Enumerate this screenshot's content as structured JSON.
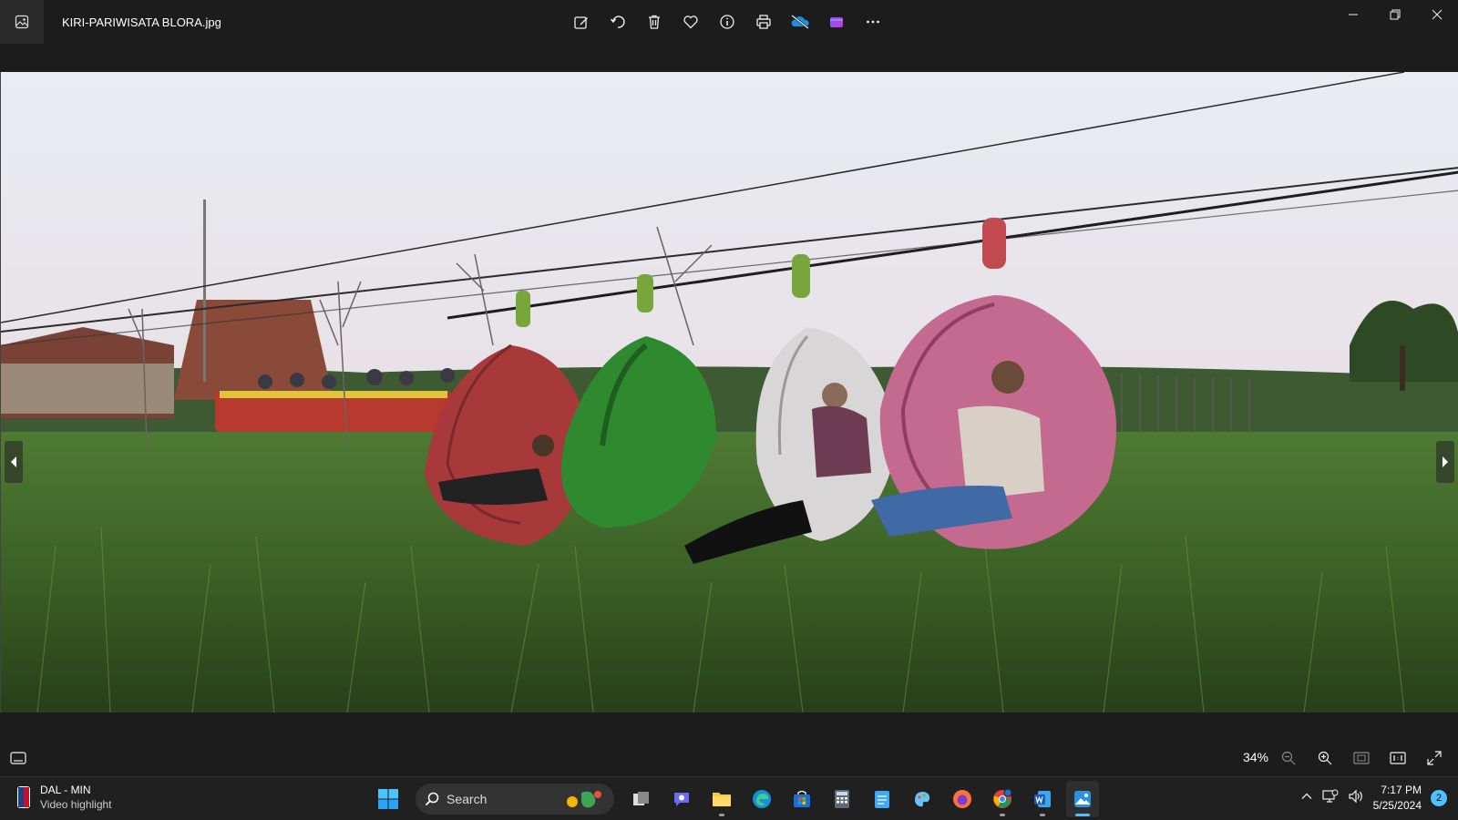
{
  "app": {
    "file_name": "KIRI-PARIWISATA BLORA.jpg",
    "toolbar": [
      "edit-icon",
      "rotate-icon",
      "delete-icon",
      "favorite-icon",
      "info-icon",
      "print-icon",
      "onedrive-icon",
      "clipchamp-icon",
      "more-icon"
    ]
  },
  "bottom_bar": {
    "zoom": "34%"
  },
  "taskbar": {
    "widget": {
      "title": "DAL - MIN",
      "subtitle": "Video highlight"
    },
    "search_placeholder": "Search",
    "clock": {
      "time": "7:17 PM",
      "date": "5/25/2024"
    },
    "notification_count": "2"
  },
  "colors": {
    "accent": "#4cc2ff",
    "background": "#1c1c1c",
    "taskbar": "#202020"
  }
}
